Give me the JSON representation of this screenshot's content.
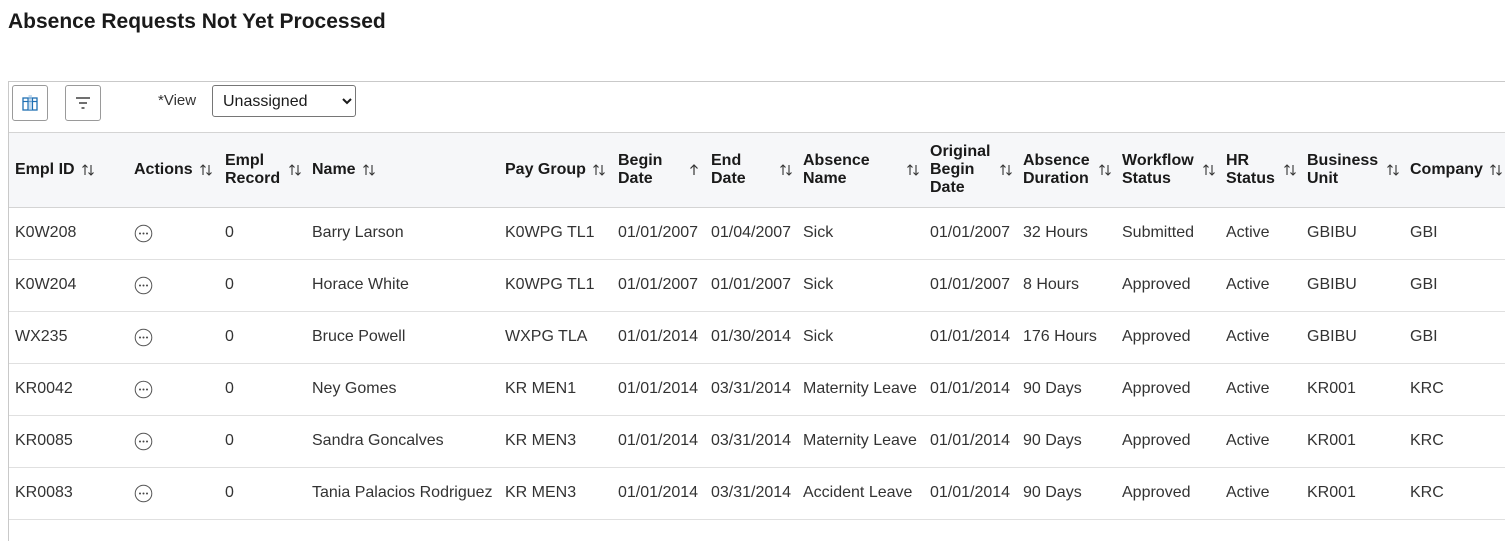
{
  "page": {
    "title": "Absence Requests Not Yet Processed"
  },
  "toolbar": {
    "view_label": "*View",
    "view_value": "Unassigned",
    "view_options": [
      "Unassigned"
    ],
    "personalize_icon": "grid-personalize-icon",
    "filter_icon": "filter-icon"
  },
  "table": {
    "columns": [
      {
        "key": "empl_id",
        "label": "Empl ID",
        "sort": "both"
      },
      {
        "key": "actions",
        "label": "Actions",
        "sort": "both"
      },
      {
        "key": "empl_record",
        "label": "Empl\nRecord",
        "sort": "both"
      },
      {
        "key": "name",
        "label": "Name",
        "sort": "both"
      },
      {
        "key": "pay_group",
        "label": "Pay Group",
        "sort": "both"
      },
      {
        "key": "begin_date",
        "label": "Begin\nDate",
        "sort": "asc"
      },
      {
        "key": "end_date",
        "label": "End\nDate",
        "sort": "both"
      },
      {
        "key": "absence_name",
        "label": "Absence\nName",
        "sort": "both"
      },
      {
        "key": "original_begin_date",
        "label": "Original\nBegin\nDate",
        "sort": "both"
      },
      {
        "key": "absence_duration",
        "label": "Absence\nDuration",
        "sort": "both"
      },
      {
        "key": "workflow_status",
        "label": "Workflow\nStatus",
        "sort": "both"
      },
      {
        "key": "hr_status",
        "label": "HR\nStatus",
        "sort": "both"
      },
      {
        "key": "business_unit",
        "label": "Business\nUnit",
        "sort": "both"
      },
      {
        "key": "company",
        "label": "Company",
        "sort": "both"
      }
    ],
    "rows": [
      {
        "empl_id": "K0W208",
        "empl_record": "0",
        "name": "Barry Larson",
        "pay_group": "K0WPG TL1",
        "begin_date": "01/01/2007",
        "end_date": "01/04/2007",
        "absence_name": "Sick",
        "original_begin_date": "01/01/2007",
        "absence_duration": "32 Hours",
        "workflow_status": "Submitted",
        "hr_status": "Active",
        "business_unit": "GBIBU",
        "company": "GBI"
      },
      {
        "empl_id": "K0W204",
        "empl_record": "0",
        "name": "Horace White",
        "pay_group": "K0WPG TL1",
        "begin_date": "01/01/2007",
        "end_date": "01/01/2007",
        "absence_name": "Sick",
        "original_begin_date": "01/01/2007",
        "absence_duration": "8 Hours",
        "workflow_status": "Approved",
        "hr_status": "Active",
        "business_unit": "GBIBU",
        "company": "GBI"
      },
      {
        "empl_id": "WX235",
        "empl_record": "0",
        "name": "Bruce Powell",
        "pay_group": "WXPG TLA",
        "begin_date": "01/01/2014",
        "end_date": "01/30/2014",
        "absence_name": "Sick",
        "original_begin_date": "01/01/2014",
        "absence_duration": "176 Hours",
        "workflow_status": "Approved",
        "hr_status": "Active",
        "business_unit": "GBIBU",
        "company": "GBI"
      },
      {
        "empl_id": "KR0042",
        "empl_record": "0",
        "name": "Ney Gomes",
        "pay_group": "KR MEN1",
        "begin_date": "01/01/2014",
        "end_date": "03/31/2014",
        "absence_name": "Maternity Leave",
        "original_begin_date": "01/01/2014",
        "absence_duration": "90 Days",
        "workflow_status": "Approved",
        "hr_status": "Active",
        "business_unit": "KR001",
        "company": "KRC"
      },
      {
        "empl_id": "KR0085",
        "empl_record": "0",
        "name": "Sandra Goncalves",
        "pay_group": "KR MEN3",
        "begin_date": "01/01/2014",
        "end_date": "03/31/2014",
        "absence_name": "Maternity Leave",
        "original_begin_date": "01/01/2014",
        "absence_duration": "90 Days",
        "workflow_status": "Approved",
        "hr_status": "Active",
        "business_unit": "KR001",
        "company": "KRC"
      },
      {
        "empl_id": "KR0083",
        "empl_record": "0",
        "name": "Tania Palacios Rodriguez",
        "pay_group": "KR MEN3",
        "begin_date": "01/01/2014",
        "end_date": "03/31/2014",
        "absence_name": "Accident Leave",
        "original_begin_date": "01/01/2014",
        "absence_duration": "90 Days",
        "workflow_status": "Approved",
        "hr_status": "Active",
        "business_unit": "KR001",
        "company": "KRC"
      }
    ]
  },
  "colors": {
    "header_bg": "#f6f7f9",
    "border": "#d4d4d4",
    "text": "#1a1a1a"
  }
}
